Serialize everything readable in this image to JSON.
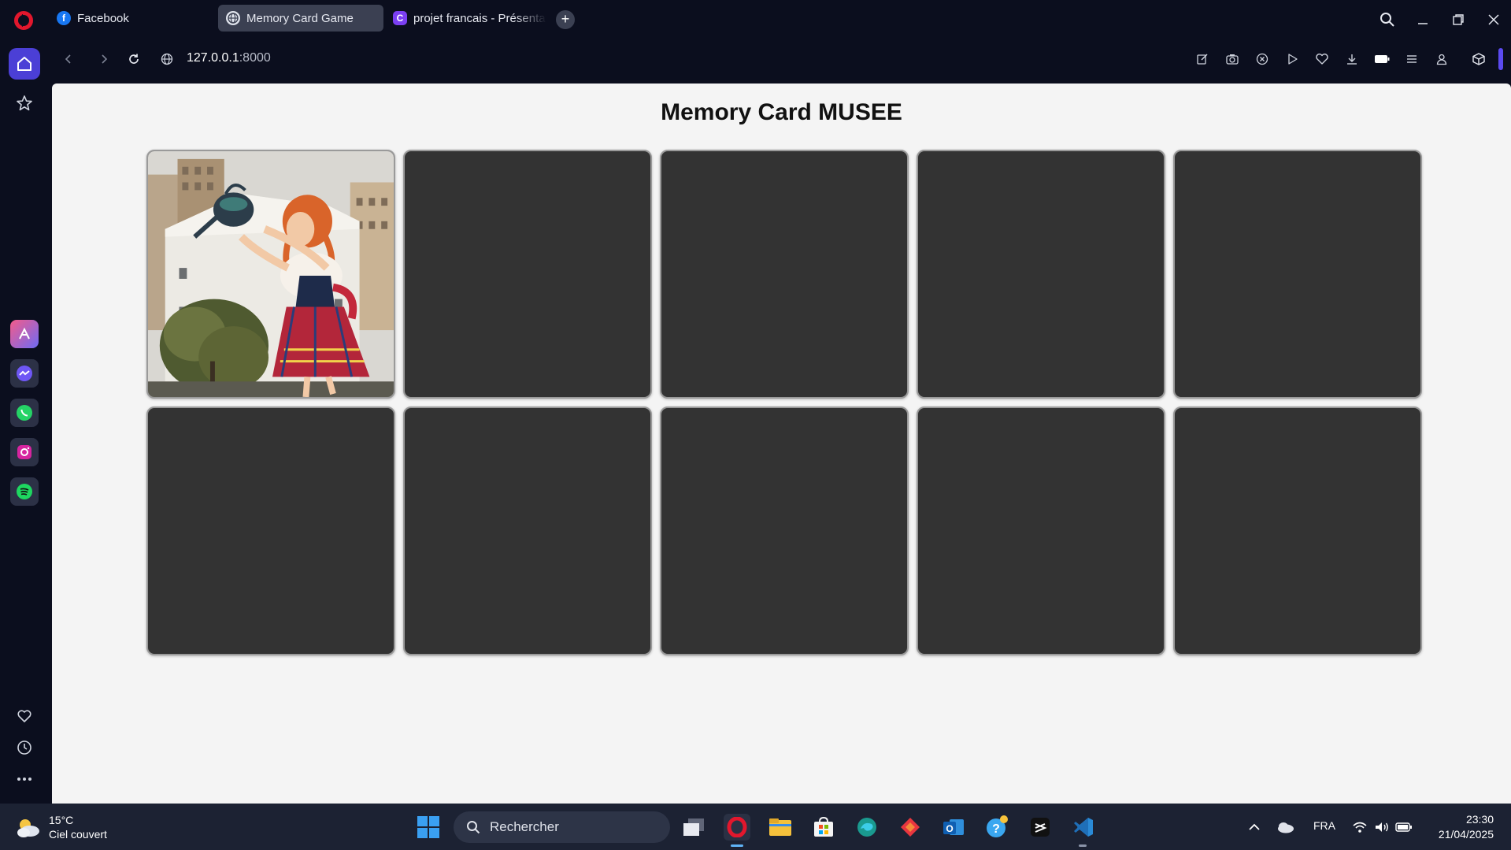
{
  "browser": {
    "tabs": [
      {
        "label": "Facebook",
        "icon": "facebook-icon",
        "active": false
      },
      {
        "label": "Memory Card Game",
        "icon": "globe-icon",
        "active": true
      },
      {
        "label": "projet francais - Présentati",
        "icon": "canva-icon",
        "active": false
      }
    ],
    "new_tab_label": "+",
    "url_host": "127.0.0.1",
    "url_port": ":8000"
  },
  "page": {
    "title": "Memory Card MUSEE",
    "cards": [
      {
        "state": "revealed",
        "image": "mural-girl-watering-can"
      },
      {
        "state": "hidden"
      },
      {
        "state": "hidden"
      },
      {
        "state": "hidden"
      },
      {
        "state": "hidden"
      },
      {
        "state": "hidden"
      },
      {
        "state": "hidden"
      },
      {
        "state": "hidden"
      },
      {
        "state": "hidden"
      },
      {
        "state": "hidden"
      }
    ],
    "card_back_color": "#333333"
  },
  "taskbar": {
    "weather_temp": "15°C",
    "weather_desc": "Ciel couvert",
    "search_placeholder": "Rechercher",
    "language": "FRA",
    "time": "23:30",
    "date": "21/04/2025"
  },
  "colors": {
    "accent": "#4b3fd6",
    "opera_red": "#e2172d",
    "page_bg": "#f4f4f4"
  }
}
